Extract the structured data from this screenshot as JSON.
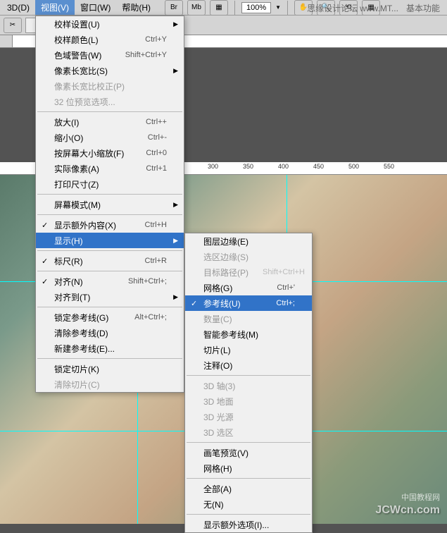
{
  "menubar": {
    "items": [
      {
        "label": "3D(D)"
      },
      {
        "label": "视图(V)"
      },
      {
        "label": "窗口(W)"
      },
      {
        "label": "帮助(H)"
      }
    ]
  },
  "toolbar": {
    "br": "Br",
    "mb": "Mb",
    "zoom": "100%",
    "right_text": "思缘设计论坛",
    "right_url": "www.MT...",
    "mode": "基本功能"
  },
  "ruler": {
    "ticks": [
      "300",
      "350",
      "400",
      "450",
      "500",
      "550"
    ]
  },
  "main_menu": [
    {
      "type": "item",
      "label": "校样设置(U)",
      "shortcut": "",
      "arrow": true
    },
    {
      "type": "item",
      "label": "校样颜色(L)",
      "shortcut": "Ctrl+Y"
    },
    {
      "type": "item",
      "label": "色域警告(W)",
      "shortcut": "Shift+Ctrl+Y"
    },
    {
      "type": "item",
      "label": "像素长宽比(S)",
      "shortcut": "",
      "arrow": true
    },
    {
      "type": "item",
      "label": "像素长宽比校正(P)",
      "disabled": true
    },
    {
      "type": "item",
      "label": "32 位预览选项...",
      "disabled": true
    },
    {
      "type": "sep"
    },
    {
      "type": "item",
      "label": "放大(I)",
      "shortcut": "Ctrl++"
    },
    {
      "type": "item",
      "label": "缩小(O)",
      "shortcut": "Ctrl+-"
    },
    {
      "type": "item",
      "label": "按屏幕大小缩放(F)",
      "shortcut": "Ctrl+0"
    },
    {
      "type": "item",
      "label": "实际像素(A)",
      "shortcut": "Ctrl+1"
    },
    {
      "type": "item",
      "label": "打印尺寸(Z)"
    },
    {
      "type": "sep"
    },
    {
      "type": "item",
      "label": "屏幕模式(M)",
      "arrow": true
    },
    {
      "type": "sep"
    },
    {
      "type": "item",
      "label": "显示额外内容(X)",
      "shortcut": "Ctrl+H",
      "checked": true
    },
    {
      "type": "item",
      "label": "显示(H)",
      "arrow": true,
      "highlighted": true
    },
    {
      "type": "sep"
    },
    {
      "type": "item",
      "label": "标尺(R)",
      "shortcut": "Ctrl+R",
      "checked": true
    },
    {
      "type": "sep"
    },
    {
      "type": "item",
      "label": "对齐(N)",
      "shortcut": "Shift+Ctrl+;",
      "checked": true
    },
    {
      "type": "item",
      "label": "对齐到(T)",
      "arrow": true
    },
    {
      "type": "sep"
    },
    {
      "type": "item",
      "label": "锁定参考线(G)",
      "shortcut": "Alt+Ctrl+;"
    },
    {
      "type": "item",
      "label": "清除参考线(D)"
    },
    {
      "type": "item",
      "label": "新建参考线(E)..."
    },
    {
      "type": "sep"
    },
    {
      "type": "item",
      "label": "锁定切片(K)"
    },
    {
      "type": "item",
      "label": "清除切片(C)",
      "disabled": true
    }
  ],
  "sub_menu": [
    {
      "type": "item",
      "label": "图层边缘(E)"
    },
    {
      "type": "item",
      "label": "选区边缘(S)",
      "disabled": true
    },
    {
      "type": "item",
      "label": "目标路径(P)",
      "shortcut": "Shift+Ctrl+H",
      "disabled": true
    },
    {
      "type": "item",
      "label": "网格(G)",
      "shortcut": "Ctrl+'"
    },
    {
      "type": "item",
      "label": "参考线(U)",
      "shortcut": "Ctrl+;",
      "highlighted": true,
      "checked": true
    },
    {
      "type": "item",
      "label": "数量(C)",
      "disabled": true
    },
    {
      "type": "item",
      "label": "智能参考线(M)"
    },
    {
      "type": "item",
      "label": "切片(L)"
    },
    {
      "type": "item",
      "label": "注释(O)"
    },
    {
      "type": "sep"
    },
    {
      "type": "item",
      "label": "3D 轴(3)",
      "disabled": true
    },
    {
      "type": "item",
      "label": "3D 地面",
      "disabled": true
    },
    {
      "type": "item",
      "label": "3D 光源",
      "disabled": true
    },
    {
      "type": "item",
      "label": "3D 选区",
      "disabled": true
    },
    {
      "type": "sep"
    },
    {
      "type": "item",
      "label": "画笔预览(V)"
    },
    {
      "type": "item",
      "label": "网格(H)"
    },
    {
      "type": "sep"
    },
    {
      "type": "item",
      "label": "全部(A)"
    },
    {
      "type": "item",
      "label": "无(N)"
    },
    {
      "type": "sep"
    },
    {
      "type": "item",
      "label": "显示额外选项(I)..."
    }
  ],
  "watermark": {
    "main": "JCWcn.com",
    "sub": "中国教程网"
  }
}
